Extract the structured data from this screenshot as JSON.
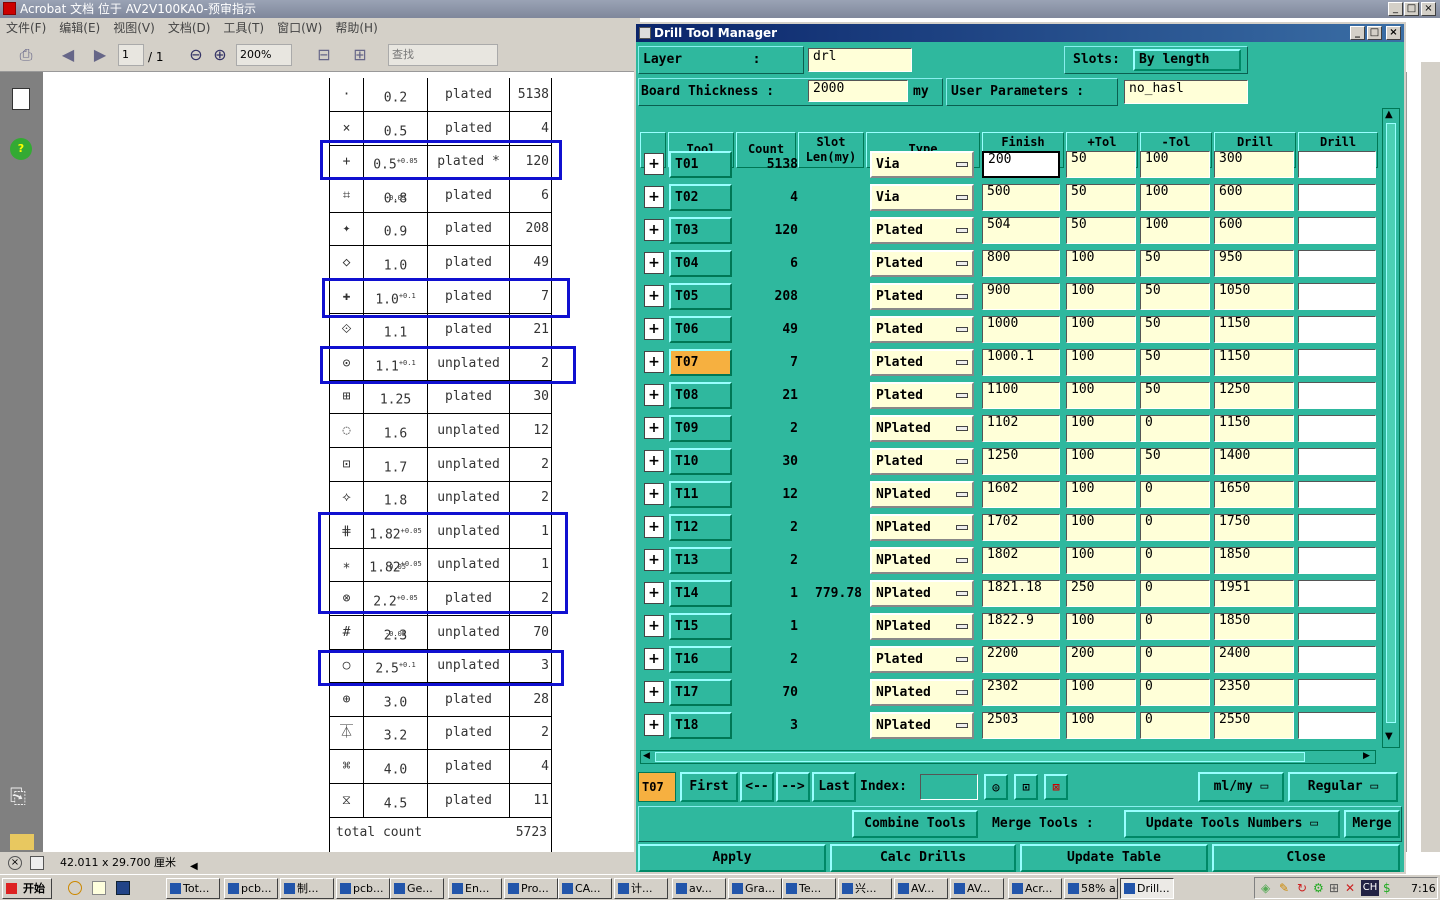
{
  "acrobat": {
    "title": "Acrobat 文档 位于 AV2V100KA0-预审指示",
    "menu": [
      "文件(F)",
      "编辑(E)",
      "视图(V)",
      "文档(D)",
      "工具(T)",
      "窗口(W)",
      "帮助(H)"
    ],
    "page_current": "1",
    "page_total": "/ 1",
    "zoom": "200%",
    "search_placeholder": "查找",
    "status_size": "42.011 x 29.700 厘米"
  },
  "pdf_table": {
    "rows": [
      {
        "symbol": "·",
        "size": "0.2",
        "sup": "",
        "type": "plated",
        "count": "5138"
      },
      {
        "symbol": "×",
        "size": "0.5",
        "sup": "",
        "type": "plated",
        "count": "4"
      },
      {
        "symbol": "+",
        "size": "0.5",
        "sup": "+0.05 -0.05",
        "type": "plated *",
        "count": "120"
      },
      {
        "symbol": "⌗",
        "size": "0.8",
        "sup": "",
        "type": "plated",
        "count": "6"
      },
      {
        "symbol": "✦",
        "size": "0.9",
        "sup": "",
        "type": "plated",
        "count": "208"
      },
      {
        "symbol": "◇",
        "size": "1.0",
        "sup": "",
        "type": "plated",
        "count": "49"
      },
      {
        "symbol": "✚",
        "size": "1.0",
        "sup": "+0.1",
        "type": "plated",
        "count": "7"
      },
      {
        "symbol": "⟐",
        "size": "1.1",
        "sup": "",
        "type": "plated",
        "count": "21"
      },
      {
        "symbol": "⊙",
        "size": "1.1",
        "sup": "+0.1",
        "type": "unplated",
        "count": "2"
      },
      {
        "symbol": "⊞",
        "size": "1.25",
        "sup": "",
        "type": "plated",
        "count": "30"
      },
      {
        "symbol": "◌",
        "size": "1.6",
        "sup": "",
        "type": "unplated",
        "count": "12"
      },
      {
        "symbol": "⊡",
        "size": "1.7",
        "sup": "",
        "type": "unplated",
        "count": "2"
      },
      {
        "symbol": "⟡",
        "size": "1.8",
        "sup": "",
        "type": "unplated",
        "count": "2"
      },
      {
        "symbol": "⋕",
        "size": "1.82",
        "sup": "+0.05 -0.05",
        "type": "unplated",
        "count": "1"
      },
      {
        "symbol": "⁎",
        "size": "1.82",
        "sup": "+0.05",
        "type": "unplated",
        "count": "1"
      },
      {
        "symbol": "⊗",
        "size": "2.2",
        "sup": "+0.05 -0.05",
        "type": "plated",
        "count": "2"
      },
      {
        "symbol": "#",
        "size": "2.3",
        "sup": "",
        "type": "unplated",
        "count": "70"
      },
      {
        "symbol": "○",
        "size": "2.5",
        "sup": "+0.1",
        "type": "unplated",
        "count": "3"
      },
      {
        "symbol": "⊕",
        "size": "3.0",
        "sup": "",
        "type": "plated",
        "count": "28"
      },
      {
        "symbol": "⏄",
        "size": "3.2",
        "sup": "",
        "type": "plated",
        "count": "2"
      },
      {
        "symbol": "⌘",
        "size": "4.0",
        "sup": "",
        "type": "plated",
        "count": "4"
      },
      {
        "symbol": "⧖",
        "size": "4.5",
        "sup": "",
        "type": "plated",
        "count": "11"
      }
    ],
    "total_label": "total count",
    "total_value": "5723"
  },
  "drill": {
    "title": "Drill Tool Manager",
    "layer_label": "Layer         :",
    "layer_value": "drl",
    "slots_label": "Slots:",
    "slots_value": "By length",
    "thickness_label": "Board Thickness :",
    "thickness_value": "2000",
    "thickness_unit": "my",
    "user_params_label": "User Parameters :",
    "user_params_value": "no_hasl",
    "headers": [
      "Tool",
      "Count",
      "Slot\nLen(my)",
      "Type",
      "Finish\nSize(my)",
      "+Tol\n(my)",
      "-Tol\n(my)",
      "Drill\nSize(my)",
      "Drill\nDes"
    ],
    "rows": [
      {
        "tool": "T01",
        "count": "5138",
        "slot": "",
        "type": "Via",
        "finish": "200",
        "ptol": "50",
        "ntol": "100",
        "drill": "300"
      },
      {
        "tool": "T02",
        "count": "4",
        "slot": "",
        "type": "Via",
        "finish": "500",
        "ptol": "50",
        "ntol": "100",
        "drill": "600"
      },
      {
        "tool": "T03",
        "count": "120",
        "slot": "",
        "type": "Plated",
        "finish": "504",
        "ptol": "50",
        "ntol": "100",
        "drill": "600"
      },
      {
        "tool": "T04",
        "count": "6",
        "slot": "",
        "type": "Plated",
        "finish": "800",
        "ptol": "100",
        "ntol": "50",
        "drill": "950"
      },
      {
        "tool": "T05",
        "count": "208",
        "slot": "",
        "type": "Plated",
        "finish": "900",
        "ptol": "100",
        "ntol": "50",
        "drill": "1050"
      },
      {
        "tool": "T06",
        "count": "49",
        "slot": "",
        "type": "Plated",
        "finish": "1000",
        "ptol": "100",
        "ntol": "50",
        "drill": "1150"
      },
      {
        "tool": "T07",
        "count": "7",
        "slot": "",
        "type": "Plated",
        "finish": "1000.1",
        "ptol": "100",
        "ntol": "50",
        "drill": "1150"
      },
      {
        "tool": "T08",
        "count": "21",
        "slot": "",
        "type": "Plated",
        "finish": "1100",
        "ptol": "100",
        "ntol": "50",
        "drill": "1250"
      },
      {
        "tool": "T09",
        "count": "2",
        "slot": "",
        "type": "NPlated",
        "finish": "1102",
        "ptol": "100",
        "ntol": "0",
        "drill": "1150"
      },
      {
        "tool": "T10",
        "count": "30",
        "slot": "",
        "type": "Plated",
        "finish": "1250",
        "ptol": "100",
        "ntol": "50",
        "drill": "1400"
      },
      {
        "tool": "T11",
        "count": "12",
        "slot": "",
        "type": "NPlated",
        "finish": "1602",
        "ptol": "100",
        "ntol": "0",
        "drill": "1650"
      },
      {
        "tool": "T12",
        "count": "2",
        "slot": "",
        "type": "NPlated",
        "finish": "1702",
        "ptol": "100",
        "ntol": "0",
        "drill": "1750"
      },
      {
        "tool": "T13",
        "count": "2",
        "slot": "",
        "type": "NPlated",
        "finish": "1802",
        "ptol": "100",
        "ntol": "0",
        "drill": "1850"
      },
      {
        "tool": "T14",
        "count": "1",
        "slot": "779.78",
        "type": "NPlated",
        "finish": "1821.18",
        "ptol": "250",
        "ntol": "0",
        "drill": "1951"
      },
      {
        "tool": "T15",
        "count": "1",
        "slot": "",
        "type": "NPlated",
        "finish": "1822.9",
        "ptol": "100",
        "ntol": "0",
        "drill": "1850"
      },
      {
        "tool": "T16",
        "count": "2",
        "slot": "",
        "type": "Plated",
        "finish": "2200",
        "ptol": "200",
        "ntol": "0",
        "drill": "2400"
      },
      {
        "tool": "T17",
        "count": "70",
        "slot": "",
        "type": "NPlated",
        "finish": "2302",
        "ptol": "100",
        "ntol": "0",
        "drill": "2350"
      },
      {
        "tool": "T18",
        "count": "3",
        "slot": "",
        "type": "NPlated",
        "finish": "2503",
        "ptol": "100",
        "ntol": "0",
        "drill": "2550"
      }
    ],
    "current_tool": "T07",
    "first": "First",
    "prev": "<--",
    "next": "-->",
    "last": "Last",
    "index_label": "Index:",
    "units": "ml/my",
    "mode": "Regular",
    "combine": "Combine Tools",
    "merge_label": "Merge Tools :",
    "merge_option": "Update Tools Numbers",
    "merge": "Merge",
    "apply": "Apply",
    "calc": "Calc Drills",
    "update_table": "Update Table",
    "close": "Close"
  },
  "taskbar": {
    "start": "开始",
    "tasks": [
      "Tot...",
      "pcb...",
      "制...",
      "pcb...",
      "Ge...",
      "En...",
      "Pro...",
      "CA...",
      "计...",
      "av...",
      "Gra...",
      "Te...",
      "兴...",
      "AV...",
      "AV...",
      "Acr...",
      "58% a...",
      "Drill..."
    ],
    "clock": "7:16",
    "lang": "CH"
  },
  "colors": {
    "panel": "#2fb89e",
    "input": "#ffffd8",
    "highlight": "#1010d0",
    "selected": "#f6b040"
  }
}
